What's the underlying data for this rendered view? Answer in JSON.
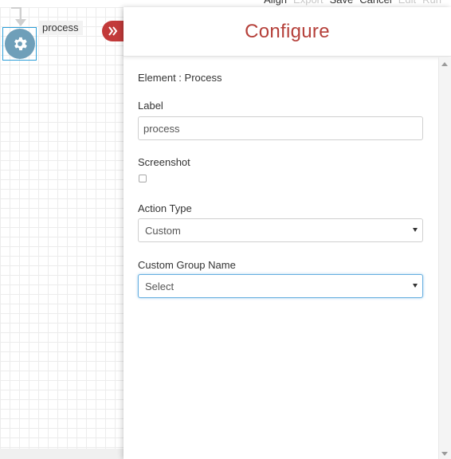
{
  "toolbar": {
    "items": [
      {
        "label": "Align",
        "enabled": true
      },
      {
        "label": "Export",
        "enabled": false
      },
      {
        "label": "Save",
        "enabled": true
      },
      {
        "label": "Cancel",
        "enabled": true
      },
      {
        "label": "Edit",
        "enabled": false
      },
      {
        "label": "Run",
        "enabled": false
      }
    ]
  },
  "canvas": {
    "node": {
      "label": "process",
      "icon": "gear-icon"
    },
    "collapse_icon": "double-chevron-right-icon"
  },
  "panel": {
    "title": "Configure",
    "element_line": "Element : Process",
    "label_field": {
      "label": "Label",
      "value": "process"
    },
    "screenshot_field": {
      "label": "Screenshot",
      "checked": false
    },
    "action_type": {
      "label": "Action Type",
      "value": "Custom"
    },
    "custom_group": {
      "label": "Custom Group Name",
      "value": "Select"
    }
  },
  "colors": {
    "accent": "#b5403a",
    "collapse_button": "#c23a3a",
    "node": "#6f9fb9",
    "focus": "#66aee0"
  }
}
